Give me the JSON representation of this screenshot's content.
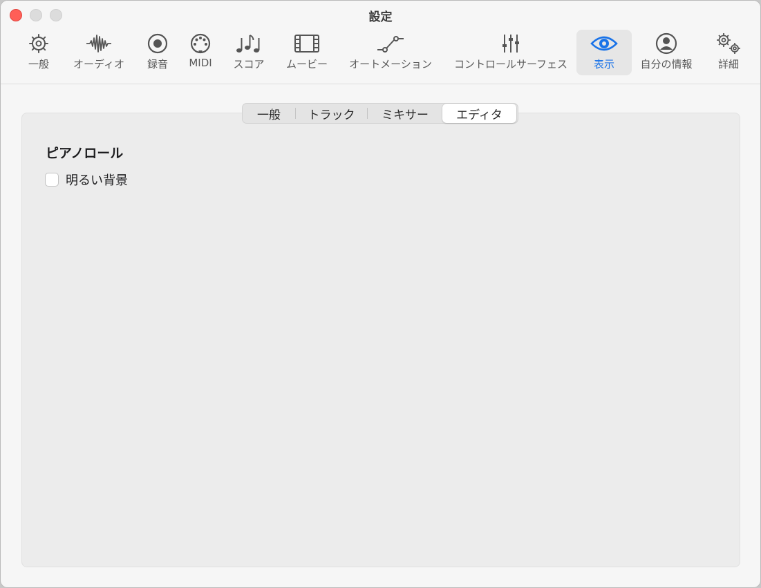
{
  "window": {
    "title": "設定"
  },
  "toolbar": {
    "items": [
      {
        "label": "一般",
        "icon": "gear-icon"
      },
      {
        "label": "オーディオ",
        "icon": "waveform-icon"
      },
      {
        "label": "録音",
        "icon": "record-icon"
      },
      {
        "label": "MIDI",
        "icon": "midi-connector-icon"
      },
      {
        "label": "スコア",
        "icon": "music-notes-icon"
      },
      {
        "label": "ムービー",
        "icon": "film-icon"
      },
      {
        "label": "オートメーション",
        "icon": "automation-curve-icon"
      },
      {
        "label": "コントロールサーフェス",
        "icon": "sliders-icon"
      },
      {
        "label": "表示",
        "icon": "eye-icon",
        "selected": true
      },
      {
        "label": "自分の情報",
        "icon": "person-icon"
      },
      {
        "label": "詳細",
        "icon": "gears-icon"
      }
    ]
  },
  "tabs": [
    {
      "label": "一般"
    },
    {
      "label": "トラック"
    },
    {
      "label": "ミキサー"
    },
    {
      "label": "エディタ",
      "active": true
    }
  ],
  "content": {
    "section_title": "ピアノロール",
    "checkbox_label": "明るい背景",
    "checkbox_checked": false
  },
  "colors": {
    "accent": "#1a73e8",
    "close_button": "#ff5f57",
    "window_bg": "#f6f6f6",
    "panel_bg": "#ececec"
  }
}
